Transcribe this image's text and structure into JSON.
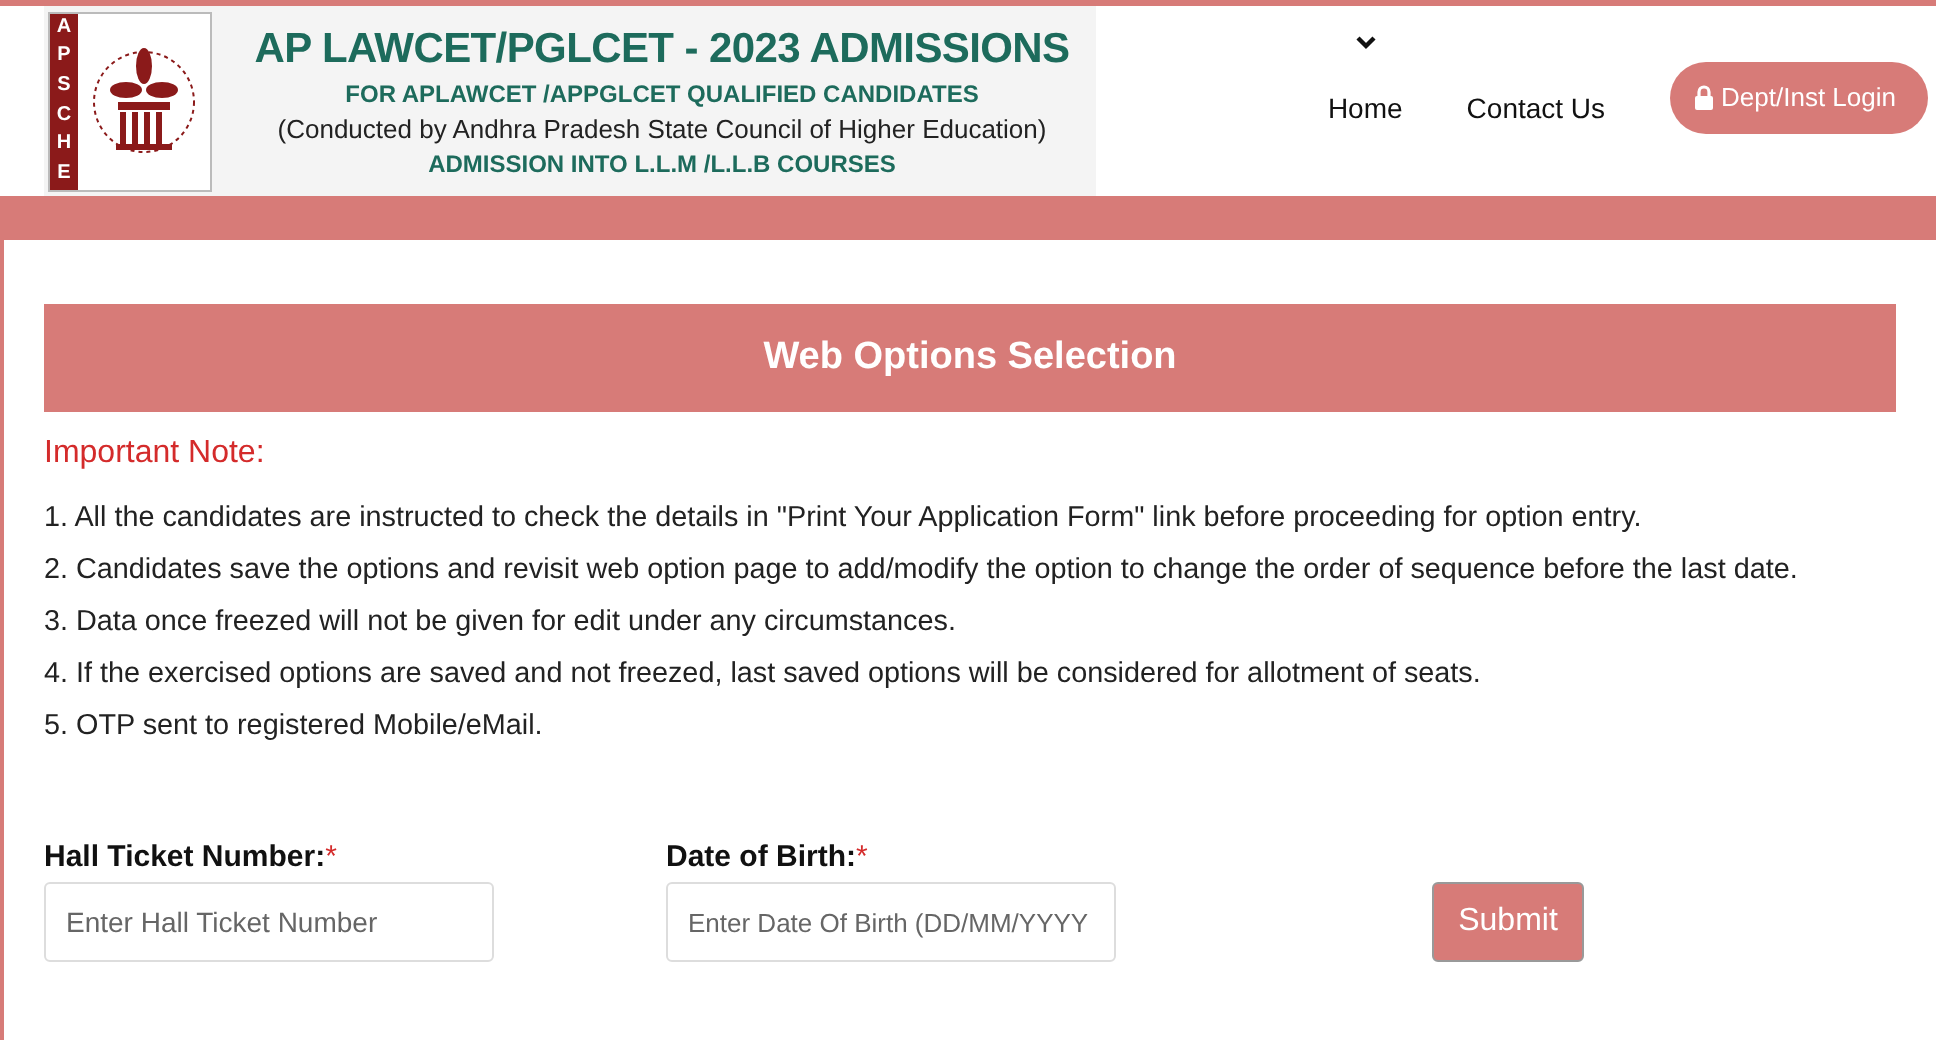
{
  "header": {
    "logo_letters": [
      "A",
      "P",
      "S",
      "C",
      "H",
      "E"
    ],
    "banner_title": "AP LAWCET/PGLCET - 2023 ADMISSIONS",
    "banner_lines": [
      "FOR APLAWCET /APPGLCET QUALIFIED CANDIDATES",
      "(Conducted by Andhra Pradesh State Council of Higher Education)",
      "ADMISSION INTO L.L.M /L.L.B COURSES"
    ],
    "nav": [
      {
        "label": "Home",
        "has_dropdown": true
      },
      {
        "label": "Contact Us",
        "has_dropdown": false
      }
    ],
    "login_button": "Dept/Inst Login"
  },
  "section_title": "Web Options Selection",
  "note_heading": "Important Note:",
  "notes": [
    "1. All the candidates are instructed to check the details in \"Print Your Application Form\" link before proceeding for option entry.",
    "2. Candidates save the options and revisit web option page to add/modify the option to change the order of sequence before the last date.",
    "3. Data once freezed will not be given for edit under any circumstances.",
    "4. If the exercised options are saved and not freezed, last saved options will be considered for allotment of seats.",
    "5. OTP sent to registered Mobile/eMail."
  ],
  "form": {
    "fields": [
      {
        "label": "Hall Ticket Number:",
        "required_mark": "*",
        "placeholder": "Enter Hall Ticket Number"
      },
      {
        "label": "Date of Birth:",
        "required_mark": "*",
        "placeholder": "Enter Date Of Birth (DD/MM/YYYY"
      }
    ],
    "submit": "Submit"
  }
}
